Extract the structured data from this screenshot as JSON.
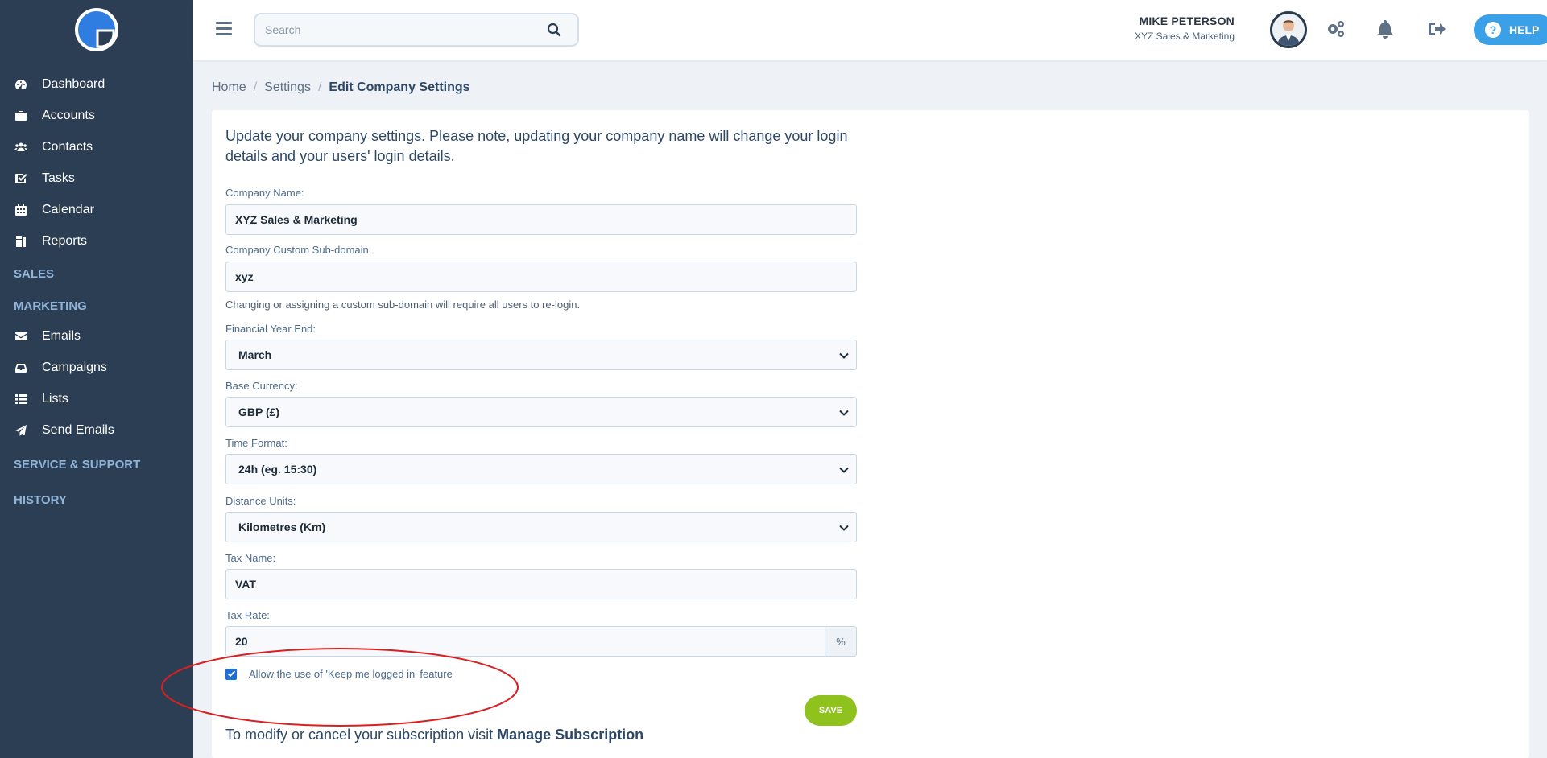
{
  "sidebar": {
    "items": [
      {
        "label": "Dashboard",
        "icon": "tachometer-icon"
      },
      {
        "label": "Accounts",
        "icon": "briefcase-icon"
      },
      {
        "label": "Contacts",
        "icon": "users-icon"
      },
      {
        "label": "Tasks",
        "icon": "check-square-icon"
      },
      {
        "label": "Calendar",
        "icon": "calendar-icon"
      },
      {
        "label": "Reports",
        "icon": "files-icon"
      }
    ],
    "section_sales": "SALES",
    "section_marketing": "MARKETING",
    "marketing_items": [
      {
        "label": "Emails",
        "icon": "envelope-icon"
      },
      {
        "label": "Campaigns",
        "icon": "inbox-icon"
      },
      {
        "label": "Lists",
        "icon": "list-icon"
      },
      {
        "label": "Send Emails",
        "icon": "paper-plane-icon"
      }
    ],
    "section_service": "SERVICE & SUPPORT",
    "section_history": "HISTORY"
  },
  "header": {
    "search_placeholder": "Search",
    "user_name": "MIKE PETERSON",
    "user_company": "XYZ Sales & Marketing",
    "help_label": "HELP"
  },
  "breadcrumb": {
    "home": "Home",
    "settings": "Settings",
    "current": "Edit Company Settings"
  },
  "form": {
    "intro": "Update your company settings. Please note, updating your company name will change your login details and your users' login details.",
    "company_name_label": "Company Name:",
    "company_name_value": "XYZ Sales & Marketing",
    "subdomain_label": "Company Custom Sub-domain",
    "subdomain_value": "xyz",
    "subdomain_hint": "Changing or assigning a custom sub-domain will require all users to re-login.",
    "fy_end_label": "Financial Year End:",
    "fy_end_value": "March",
    "currency_label": "Base Currency:",
    "currency_value": "GBP (£)",
    "time_format_label": "Time Format:",
    "time_format_value": "24h (eg. 15:30)",
    "distance_label": "Distance Units:",
    "distance_value": "Kilometres (Km)",
    "tax_name_label": "Tax Name:",
    "tax_name_value": "VAT",
    "tax_rate_label": "Tax Rate:",
    "tax_rate_value": "20",
    "tax_rate_unit": "%",
    "keep_logged_in_label": "Allow the use of 'Keep me logged in' feature",
    "keep_logged_in_checked": true,
    "save_label": "SAVE",
    "subscription_text": "To modify or cancel your subscription visit",
    "subscription_link": "Manage Subscription"
  },
  "colors": {
    "sidebar_bg": "#2c3e53",
    "accent_blue": "#3aa0e8",
    "save_green": "#8fc21d",
    "annotation_red": "#d91f1f"
  }
}
